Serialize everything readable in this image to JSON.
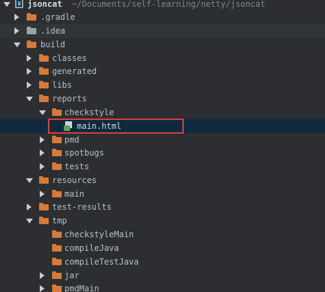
{
  "project": {
    "name": "jsoncat",
    "path": "~/Documents/self-learning/netty/jsoncat"
  },
  "tree": {
    "gradle": ".gradle",
    "idea": ".idea",
    "build": "build",
    "classes": "classes",
    "generated": "generated",
    "libs": "libs",
    "reports": "reports",
    "checkstyle": "checkstyle",
    "main_html": "main.html",
    "pmd": "pmd",
    "spotbugs": "spotbugs",
    "tests": "tests",
    "resources": "resources",
    "resources_main": "main",
    "test_results": "test-results",
    "tmp": "tmp",
    "checkstyleMain": "checkstyleMain",
    "compileJava": "compileJava",
    "compileTestJava": "compileTestJava",
    "jar": "jar",
    "pmdMain": "pmdMain"
  },
  "colors": {
    "folder": "#d87a3a",
    "excluded_folder": "#9aa3ad",
    "selection": "#0f2a3f",
    "highlight_border": "#e0413f"
  },
  "icons": {
    "module": "module-icon",
    "folder": "folder-icon",
    "html_file": "html-file-icon",
    "expand": "chevron-down-icon",
    "collapse": "chevron-right-icon"
  }
}
